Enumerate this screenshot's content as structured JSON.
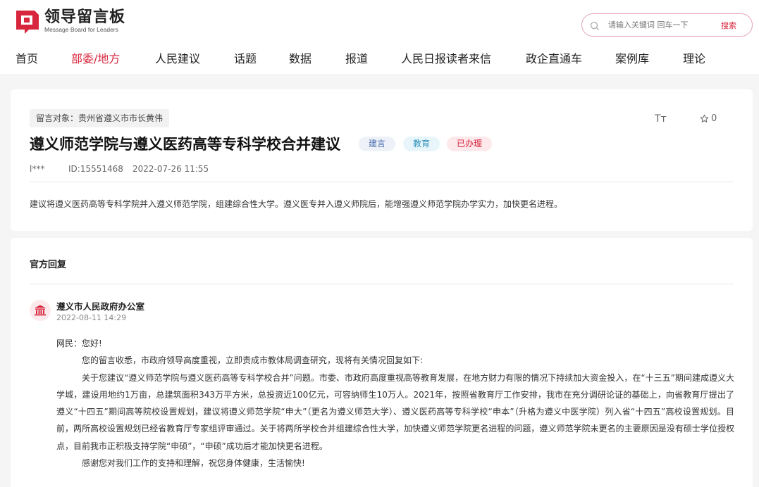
{
  "header": {
    "logo_title": "领导留言板",
    "logo_sub": "Message Board for Leaders",
    "search_placeholder": "请输入关键词 回车一下",
    "search_button": "搜索",
    "brand_color": "#d7263d"
  },
  "nav": {
    "items": [
      "首页",
      "部委/地方",
      "人民建议",
      "话题",
      "数据",
      "报道",
      "人民日报读者来信",
      "政企直通车",
      "案例库",
      "理论"
    ],
    "active_index": 1
  },
  "message": {
    "target": "留言对象：贵州省遵义市市长黄伟",
    "font_tool": "Tт",
    "favorite_count": "0",
    "title": "遵义师范学院与遵义医药高等专科学校合并建议",
    "tags": [
      "建言",
      "教育",
      "已办理"
    ],
    "user": "l***",
    "id": "ID:15551468",
    "time": "2022-07-26 11:55",
    "content": "建议将遵义医药高等专科学院并入遵义师范学院，组建综合性大学。遵义医专并入遵义师院后，能增强遵义师范学院办学实力，加快更名进程。"
  },
  "reply": {
    "heading": "官方回复",
    "org": "遵义市人民政府办公室",
    "time": "2022-08-11 14:29",
    "greeting": "网民：您好!",
    "para1": "您的留言收悉，市政府领导高度重视，立即责成市教体局调查研究，现将有关情况回复如下:",
    "para2": "关于您建议“遵义师范学院与遵义医药高等专科学校合并”问题。市委、市政府高度重视高等教育发展，在地方财力有限的情况下持续加大资金投入，在“十三五”期间建成遵义大学城，建设用地约1万亩，总建筑面积343万平方米，总投资近100亿元，可容纳师生10万人。2021年，按照省教育厅工作安排，我市在充分调研论证的基础上，向省教育厅提出了遵义“十四五”期间高等院校设置规划，建议将遵义师范学院“申大”（更名为遵义师范大学）、遵义医药高等专科学校“申本”（升格为遵义中医学院）列入省“十四五”高校设置规划。目前，两所高校设置规划已经省教育厅专家组评审通过。关于将两所学校合并组建综合性大学，加快遵义师范学院更名进程的问题，遵义师范学院未更名的主要原因是没有硕士学位授权点，目前我市正积极支持学院“申硕”，“申硕”成功后才能加快更名进程。",
    "para3": "感谢您对我们工作的支持和理解，祝您身体健康，生活愉快!"
  }
}
